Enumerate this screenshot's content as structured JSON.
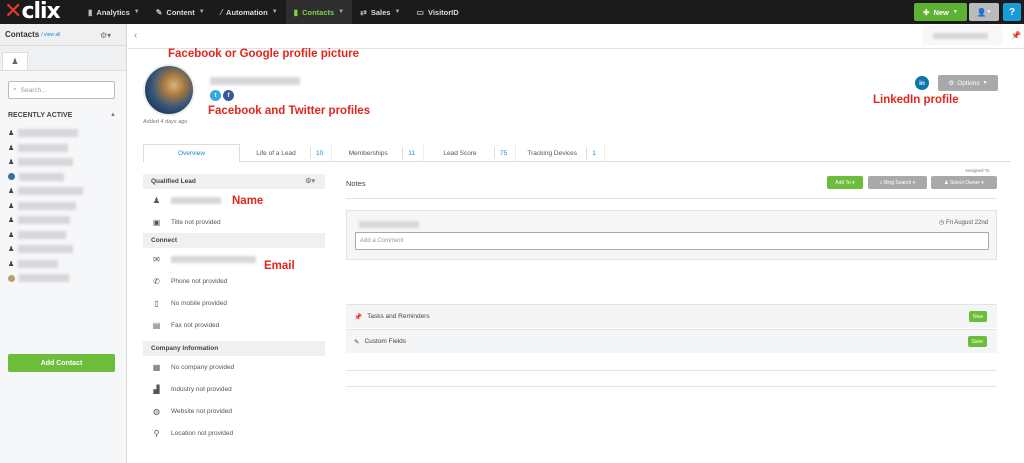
{
  "topbar": {
    "logo": "clix",
    "nav": [
      {
        "label": "Analytics",
        "icon": "bar-chart-icon"
      },
      {
        "label": "Content",
        "icon": "pencil-icon"
      },
      {
        "label": "Automation",
        "icon": "wand-icon"
      },
      {
        "label": "Contacts",
        "icon": "contacts-icon"
      },
      {
        "label": "Sales",
        "icon": "handshake-icon"
      },
      {
        "label": "VisitorID",
        "icon": "id-card-icon"
      }
    ],
    "new_label": "New",
    "help_label": "?"
  },
  "sidebar": {
    "title": "Contacts",
    "view_all": "/ view all",
    "search_placeholder": "Search...",
    "recent_label": "RECENTLY ACTIVE",
    "add_contact": "Add Contact"
  },
  "profile": {
    "added": "Added 4 days ago",
    "options_label": "Options",
    "linkedin_label": "in"
  },
  "annotations": {
    "picture": "Facebook or Google profile picture",
    "social": "Facebook and Twitter profiles",
    "linkedin": "LinkedIn profile",
    "name": "Name",
    "email": "Email"
  },
  "tabs": [
    {
      "label": "Overview",
      "count": ""
    },
    {
      "label": "Life of a Lead",
      "count": "10"
    },
    {
      "label": "Memberships",
      "count": "11"
    },
    {
      "label": "Lead Score",
      "count": "75"
    },
    {
      "label": "Tracking Devices",
      "count": "1"
    }
  ],
  "details": {
    "qualified": "Qualified Lead",
    "title": "Title not provided",
    "connect": "Connect",
    "phone": "Phone not provided",
    "mobile": "No mobile provided",
    "fax": "Fax not provided",
    "company_head": "Company Information",
    "company": "No company provided",
    "industry": "Industry not provided",
    "website": "Website not provided",
    "location": "Location not provided"
  },
  "notes": {
    "title": "Notes",
    "assigned": "Assigned To",
    "add_to": "Add To",
    "bing": "Bing Search",
    "owner": "Select Owner",
    "date": "Fri August 22nd",
    "comment_placeholder": "Add a Comment",
    "tasks": "Tasks and Reminders",
    "tasks_btn": "New",
    "custom": "Custom Fields",
    "custom_btn": "Save"
  }
}
